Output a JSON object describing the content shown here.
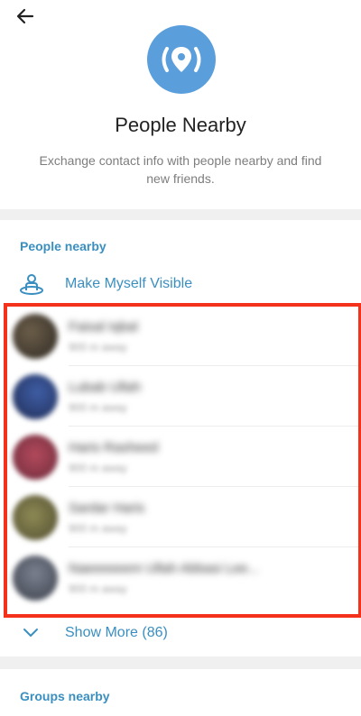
{
  "header": {
    "title": "People Nearby",
    "subtitle": "Exchange contact info with people nearby and find new friends.",
    "accent_color": "#5a9fdc",
    "hero_icon": "location-radar-icon",
    "back_icon": "back-arrow-icon"
  },
  "people_section": {
    "heading": "People nearby",
    "make_visible_label": "Make Myself Visible",
    "make_visible_icon": "person-broadcast-icon",
    "people": [
      {
        "name": "Faisal Iqbal",
        "distance": "900 m away"
      },
      {
        "name": "Lubab Ullah",
        "distance": "900 m away"
      },
      {
        "name": "Haris Rasheed",
        "distance": "900 m away"
      },
      {
        "name": "Sardar Haris",
        "distance": "900 m away"
      },
      {
        "name": "Naeeeeeem Ullah Abbasi Lee...",
        "distance": "900 m away"
      }
    ],
    "show_more_label": "Show More (86)",
    "show_more_icon": "chevron-down-icon",
    "highlight_color": "#f4321c"
  },
  "groups_section": {
    "heading": "Groups nearby"
  }
}
